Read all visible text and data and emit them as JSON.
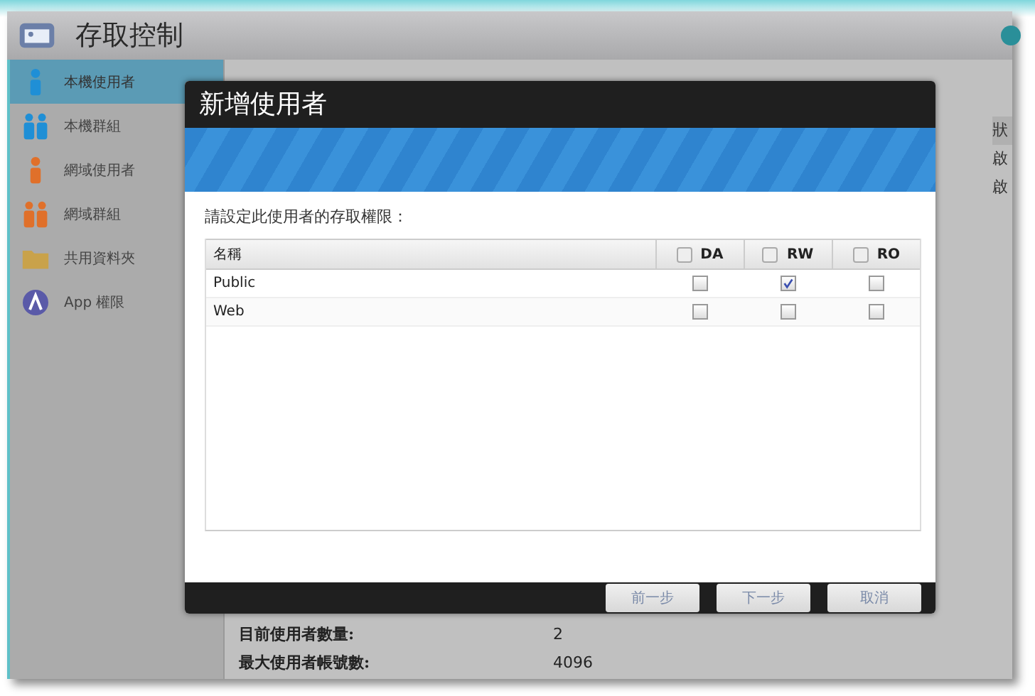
{
  "window": {
    "title": "存取控制"
  },
  "sidebar": {
    "items": [
      {
        "label": "本機使用者",
        "selected": true
      },
      {
        "label": "本機群組",
        "selected": false
      },
      {
        "label": "網域使用者",
        "selected": false
      },
      {
        "label": "網域群組",
        "selected": false
      },
      {
        "label": "共用資料夾",
        "selected": false
      },
      {
        "label": "App 權限",
        "selected": false
      }
    ]
  },
  "background_table": {
    "column_header": "狀",
    "cells": [
      "啟",
      "啟"
    ]
  },
  "stats": [
    {
      "label": "目前使用者數量:",
      "value": "2"
    },
    {
      "label": "最大使用者帳號數:",
      "value": "4096"
    }
  ],
  "dialog": {
    "title": "新增使用者",
    "instruction": "請設定此使用者的存取權限：",
    "columns": [
      {
        "label": "名稱"
      },
      {
        "label": "DA",
        "checked": false
      },
      {
        "label": "RW",
        "checked": false
      },
      {
        "label": "RO",
        "checked": false
      }
    ],
    "rows": [
      {
        "name": "Public",
        "da": false,
        "rw": true,
        "ro": false
      },
      {
        "name": "Web",
        "da": false,
        "rw": false,
        "ro": false
      }
    ],
    "buttons": [
      {
        "label": "前一步"
      },
      {
        "label": "下一步"
      },
      {
        "label": "取消"
      }
    ]
  }
}
